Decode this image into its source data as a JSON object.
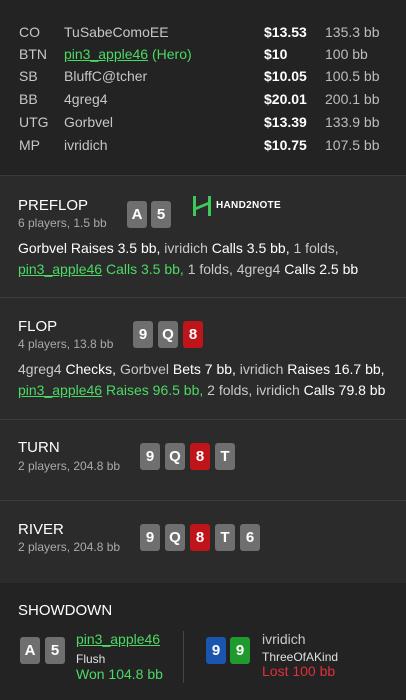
{
  "players": [
    {
      "pos": "CO",
      "name": "TuSabeComoEE",
      "stack": "$13.53",
      "bb": "135.3 bb"
    },
    {
      "pos": "BTN",
      "name": "pin3_apple46",
      "hero_tag": "(Hero)",
      "stack": "$10",
      "bb": "100 bb"
    },
    {
      "pos": "SB",
      "name": "BluffC@tcher",
      "stack": "$10.05",
      "bb": "100.5 bb"
    },
    {
      "pos": "BB",
      "name": "4greg4",
      "stack": "$20.01",
      "bb": "200.1 bb"
    },
    {
      "pos": "UTG",
      "name": "Gorbvel",
      "stack": "$13.39",
      "bb": "133.9 bb"
    },
    {
      "pos": "MP",
      "name": "ivridich",
      "stack": "$10.75",
      "bb": "107.5 bb"
    }
  ],
  "brand": {
    "text": "HAND2NOTE"
  },
  "preflop": {
    "title": "PREFLOP",
    "sub": "6 players, 1.5 bb",
    "cards": [
      "A",
      "5"
    ],
    "a1_name": "Gorbvel",
    "a1_act": " Raises 3.5 bb,",
    "a2_name": " ivridich",
    "a2_act": " Calls 3.5 bb,",
    "a3": " 1 folds,",
    "a4_name": "pin3_apple46",
    "a4_act": " Calls 3.5 bb,",
    "a5": " 1 folds,",
    "a6_name": " 4greg4",
    "a6_act": " Calls 2.5 bb"
  },
  "flop": {
    "title": "FLOP",
    "sub": "4 players, 13.8 bb",
    "cards": [
      "9",
      "Q",
      "8"
    ],
    "a1_name": "4greg4",
    "a1_act": " Checks,",
    "a2_name": " Gorbvel",
    "a2_act": " Bets 7 bb,",
    "a3_name": " ivridich",
    "a3_act": " Raises 16.7 bb,",
    "a4_name": "pin3_apple46",
    "a4_act": " Raises 96.5 bb,",
    "a5": " 2 folds,",
    "a6_name": " ivridich",
    "a6_act": " Calls 79.8 bb"
  },
  "turn": {
    "title": "TURN",
    "sub": "2 players, 204.8 bb",
    "cards": [
      "9",
      "Q",
      "8",
      "T"
    ]
  },
  "river": {
    "title": "RIVER",
    "sub": "2 players, 204.8 bb",
    "cards": [
      "9",
      "Q",
      "8",
      "T",
      "6"
    ]
  },
  "showdown": {
    "title": "SHOWDOWN",
    "hero": {
      "cards": [
        "A",
        "5"
      ],
      "name": "pin3_apple46",
      "hand": "Flush",
      "result": "Won 104.8 bb"
    },
    "villain": {
      "cards": [
        "9",
        "9"
      ],
      "name": "ivridich",
      "hand": "ThreeOfAKind",
      "result": "Lost 100 bb"
    }
  },
  "colors": {
    "hero": "#4cd964",
    "lost": "#e0303a",
    "card_red": "#c0141b",
    "card_grey": "#6f6f6f",
    "card_blue": "#1a56b0",
    "card_green": "#1f9a2e"
  }
}
